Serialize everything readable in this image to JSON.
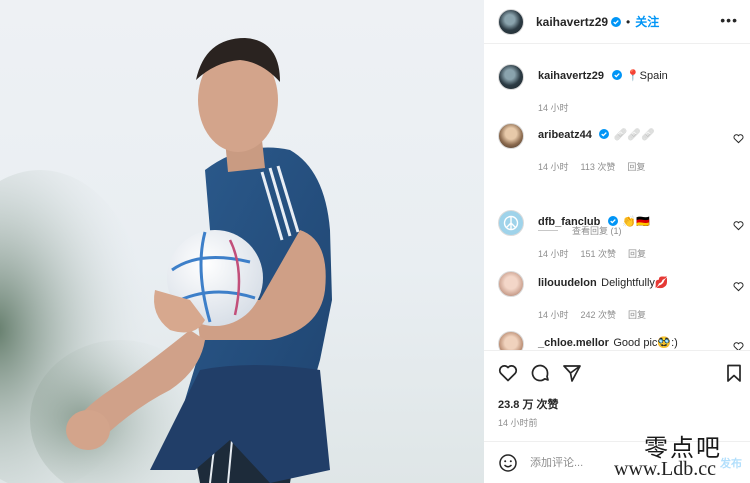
{
  "post": {
    "author": "kaihavertz29",
    "follow_label": "关注",
    "dot": "•",
    "more_icon": "more-horizontal-icon",
    "verified_color": "#0095f6"
  },
  "caption": {
    "username": "kaihavertz29",
    "pin": "📍",
    "text": "Spain",
    "time": "14 小时"
  },
  "comments": [
    {
      "username": "aribeatz44",
      "text": "🩹🩹🩹",
      "time": "14 小时",
      "likes": "113 次赞",
      "reply": "回复",
      "verified": true
    },
    {
      "username": "dfb_fanclub",
      "text": "👏🇩🇪",
      "time": "14 小时",
      "likes": "151 次赞",
      "reply": "回复",
      "verified": true
    },
    {
      "username": "lilouudelon",
      "text": "Delightfully💋",
      "time": "14 小时",
      "likes": "242 次赞",
      "reply": "回复",
      "verified": false
    },
    {
      "username": "_chloe.mellor",
      "text": "Good pic🥸:)",
      "verified": false
    }
  ],
  "view_replies": "查看回复 (1)",
  "actions": {
    "like_icon": "heart-icon",
    "comment_icon": "comment-icon",
    "share_icon": "share-icon",
    "save_icon": "bookmark-icon"
  },
  "likes_count": "23.8 万 次赞",
  "post_time": "14 小时前",
  "add_comment": {
    "placeholder": "添加评论...",
    "post_label": "发布"
  },
  "watermark": {
    "cn": "零点吧",
    "url": "www.Ldb.cc"
  }
}
